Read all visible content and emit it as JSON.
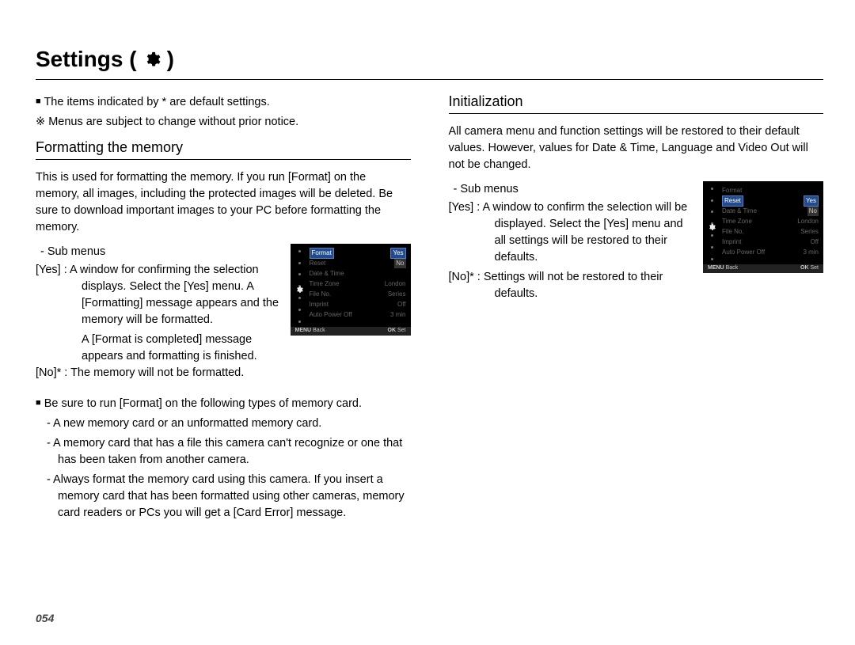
{
  "title_prefix": "Settings (",
  "title_suffix": " )",
  "note_default": "The items indicated by * are default settings.",
  "note_change": "Menus are subject to change without prior notice.",
  "glyph_square": "■",
  "glyph_ref": "※",
  "pagenum": "054",
  "format": {
    "heading": "Formatting the memory",
    "intro": "This is used for formatting the memory. If you run [Format] on the memory, all images, including the protected images will be deleted. Be sure to download important images to your PC before formatting the memory.",
    "sub_label": "- Sub menus",
    "yes_key": "[Yes]  :",
    "yes_text1": "A window for confirming the selection displays. Select the [Yes] menu. A [Formatting] message appears and the memory will be formatted.",
    "yes_text2": "A [Format is completed] message appears and formatting is finished.",
    "no_key": "[No]* :",
    "no_text": "The memory will not be formatted.",
    "bullets_lead": "Be sure to run [Format] on the following types of memory card.",
    "b1": "- A new memory card or an unformatted memory card.",
    "b2": "- A memory card that has a file this camera can't recognize or one that has been taken from another camera.",
    "b3": "- Always format the memory card using this camera. If you insert a memory card that has been formatted using other cameras, memory card readers or PCs you will get a [Card Error] message."
  },
  "init": {
    "heading": "Initialization",
    "intro": "All camera menu and function settings will be restored to their default values. However, values for Date & Time, Language and Video Out will not be changed.",
    "sub_label": "- Sub menus",
    "yes_key": "[Yes]  :",
    "yes_text": "A window to confirm the selection will be displayed. Select the [Yes] menu and all settings will be restored to their defaults.",
    "no_key": "[No]* :",
    "no_text": "Settings will not be restored to their defaults."
  },
  "screen": {
    "items": [
      {
        "l": "Format",
        "r": ""
      },
      {
        "l": "Reset",
        "r": ""
      },
      {
        "l": "Date & Time",
        "r": ""
      },
      {
        "l": "Time Zone",
        "r": "London"
      },
      {
        "l": "File No.",
        "r": "Series"
      },
      {
        "l": "Imprint",
        "r": "Off"
      },
      {
        "l": "Auto Power Off",
        "r": "3 min"
      }
    ],
    "popup_yes": "Yes",
    "popup_no": "No",
    "back": "Back",
    "set": "Set",
    "menu": "MENU",
    "ok": "OK"
  }
}
